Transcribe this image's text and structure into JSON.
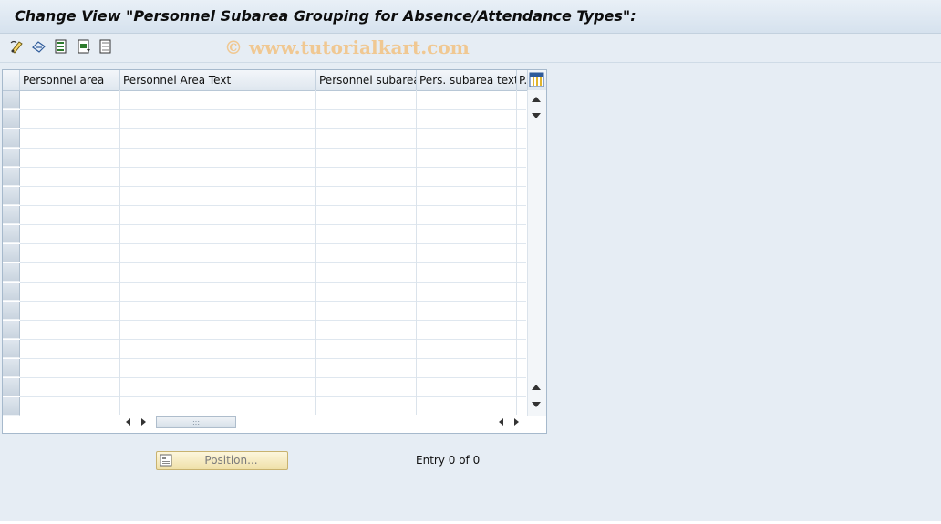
{
  "title": "Change View \"Personnel Subarea Grouping for Absence/Attendance Types\":",
  "watermark": "© www.tutorialkart.com",
  "toolbar": {
    "buttons": [
      {
        "name": "display-change-icon"
      },
      {
        "name": "other-view-icon"
      },
      {
        "name": "select-all-icon"
      },
      {
        "name": "select-block-icon"
      },
      {
        "name": "deselect-all-icon"
      }
    ]
  },
  "table": {
    "columns": [
      "Personnel area",
      "Personnel Area Text",
      "Personnel subarea",
      "Pers. subarea text",
      "P..."
    ],
    "rows": [],
    "empty_row_count": 17
  },
  "position_button": {
    "label": "Position..."
  },
  "entry_text": "Entry 0 of 0"
}
